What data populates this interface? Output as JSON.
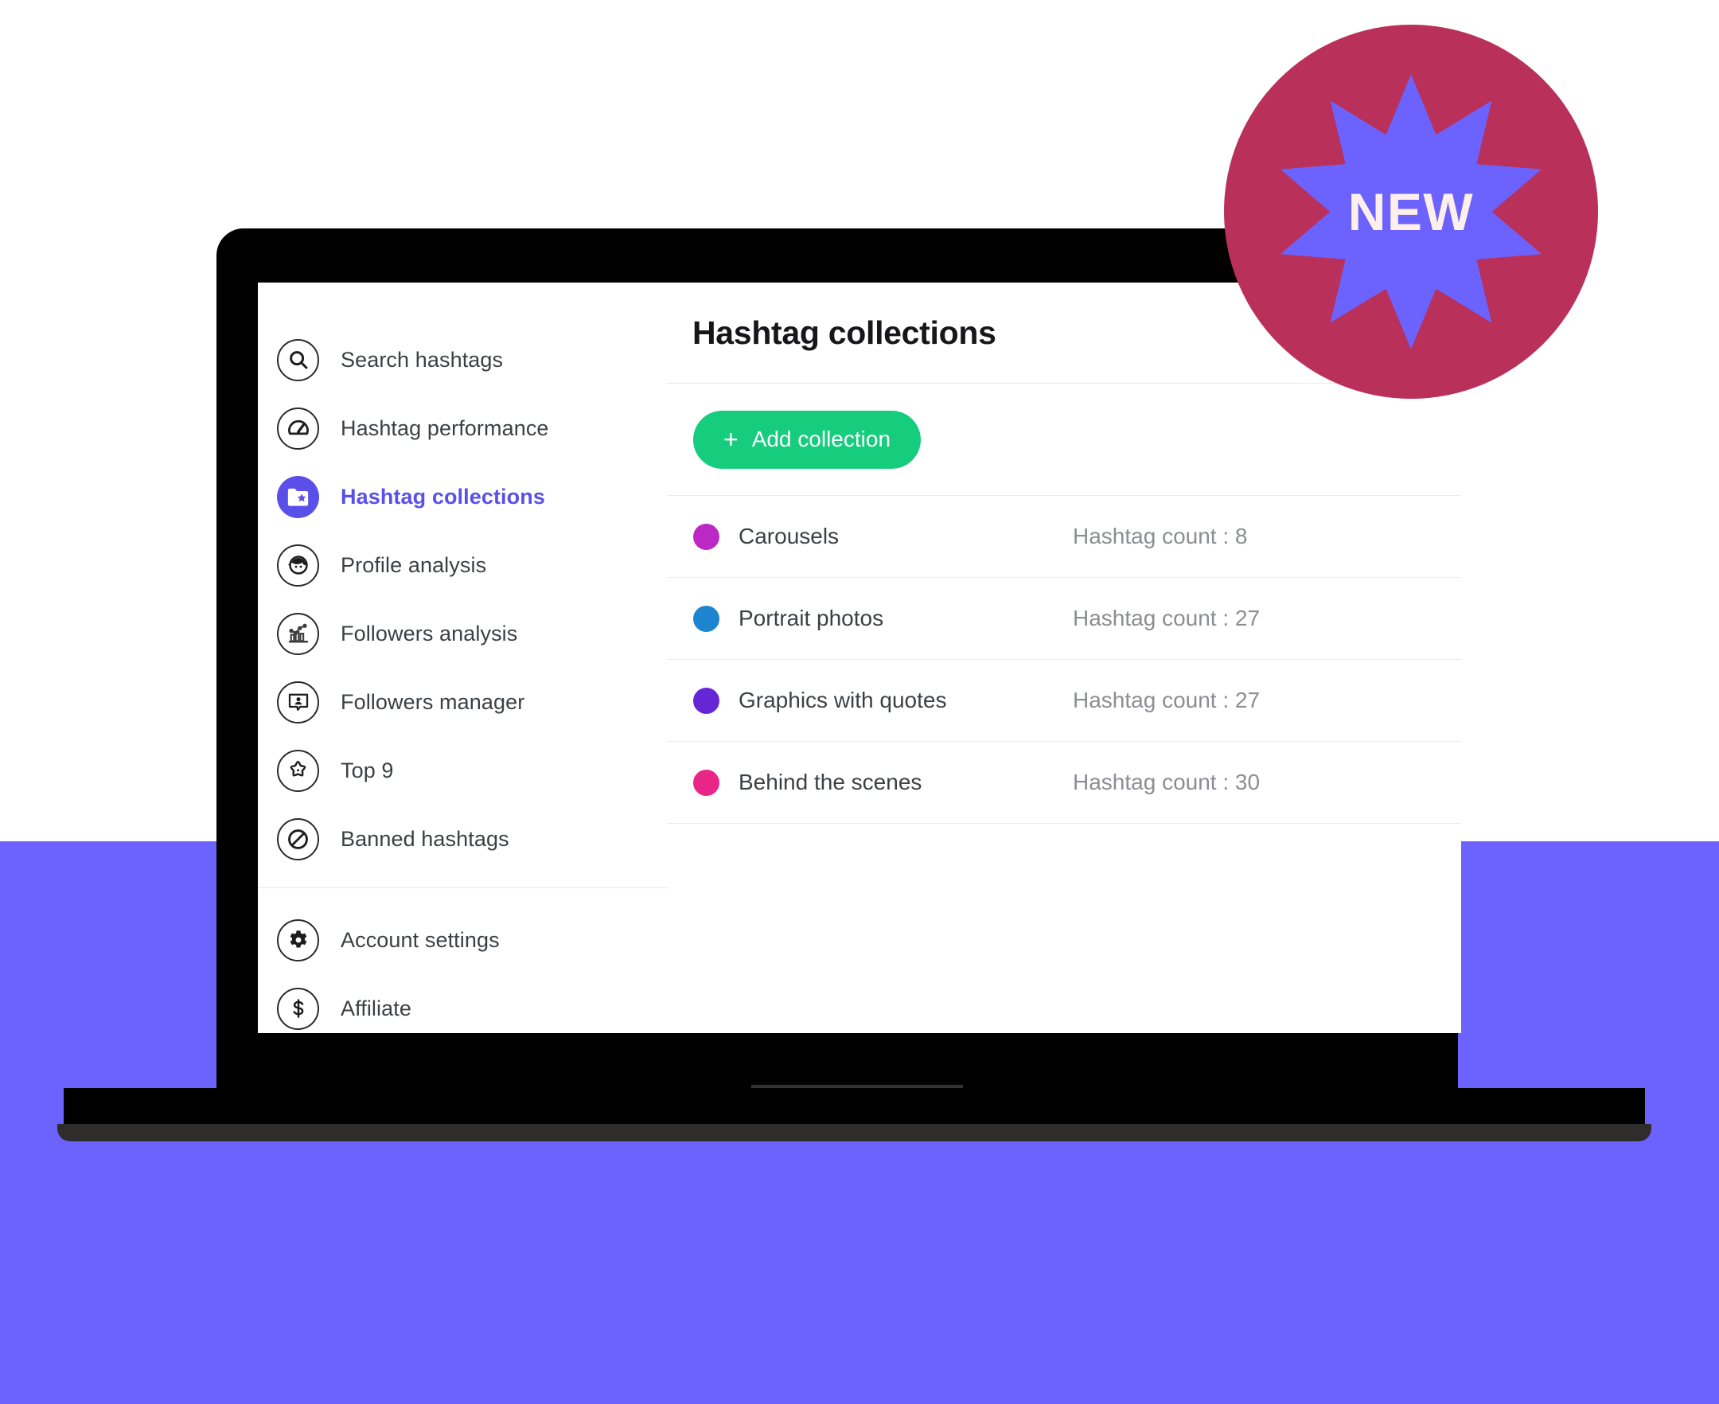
{
  "app": {
    "page_title": "Hashtag collections",
    "accent_color": "#5b4fe9",
    "background_color": "#6c63ff",
    "button_color": "#16cc7d"
  },
  "badge": {
    "label": "NEW",
    "circle_color": "#b9305b",
    "star_color": "#6c63ff",
    "text_color": "#fdf0ea"
  },
  "sidebar": {
    "items": [
      {
        "label": "Search hashtags",
        "icon": "search-icon",
        "active": false
      },
      {
        "label": "Hashtag performance",
        "icon": "speedometer-icon",
        "active": false
      },
      {
        "label": "Hashtag collections",
        "icon": "folder-star-icon",
        "active": true
      },
      {
        "label": "Profile analysis",
        "icon": "person-face-icon",
        "active": false
      },
      {
        "label": "Followers analysis",
        "icon": "bar-chart-icon",
        "active": false
      },
      {
        "label": "Followers manager",
        "icon": "person-speech-bubble-icon",
        "active": false
      },
      {
        "label": "Top 9",
        "icon": "star-outline-icon",
        "active": false
      },
      {
        "label": "Banned hashtags",
        "icon": "prohibition-icon",
        "active": false
      }
    ],
    "footer_items": [
      {
        "label": "Account settings",
        "icon": "gear-icon",
        "active": false
      },
      {
        "label": "Affiliate",
        "icon": "dollar-icon",
        "active": false
      }
    ]
  },
  "toolbar": {
    "add_collection_label": "Add collection",
    "add_collection_plus": "+"
  },
  "collections": [
    {
      "name": "Carousels",
      "count_label": "Hashtag count : 8",
      "count": 8,
      "color": "#bb28c4"
    },
    {
      "name": "Portrait photos",
      "count_label": "Hashtag count : 27",
      "count": 27,
      "color": "#1d84d0"
    },
    {
      "name": "Graphics with quotes",
      "count_label": "Hashtag count : 27",
      "count": 27,
      "color": "#6726d6"
    },
    {
      "name": "Behind the scenes",
      "count_label": "Hashtag count : 30",
      "count": 30,
      "color": "#ea2588"
    }
  ]
}
